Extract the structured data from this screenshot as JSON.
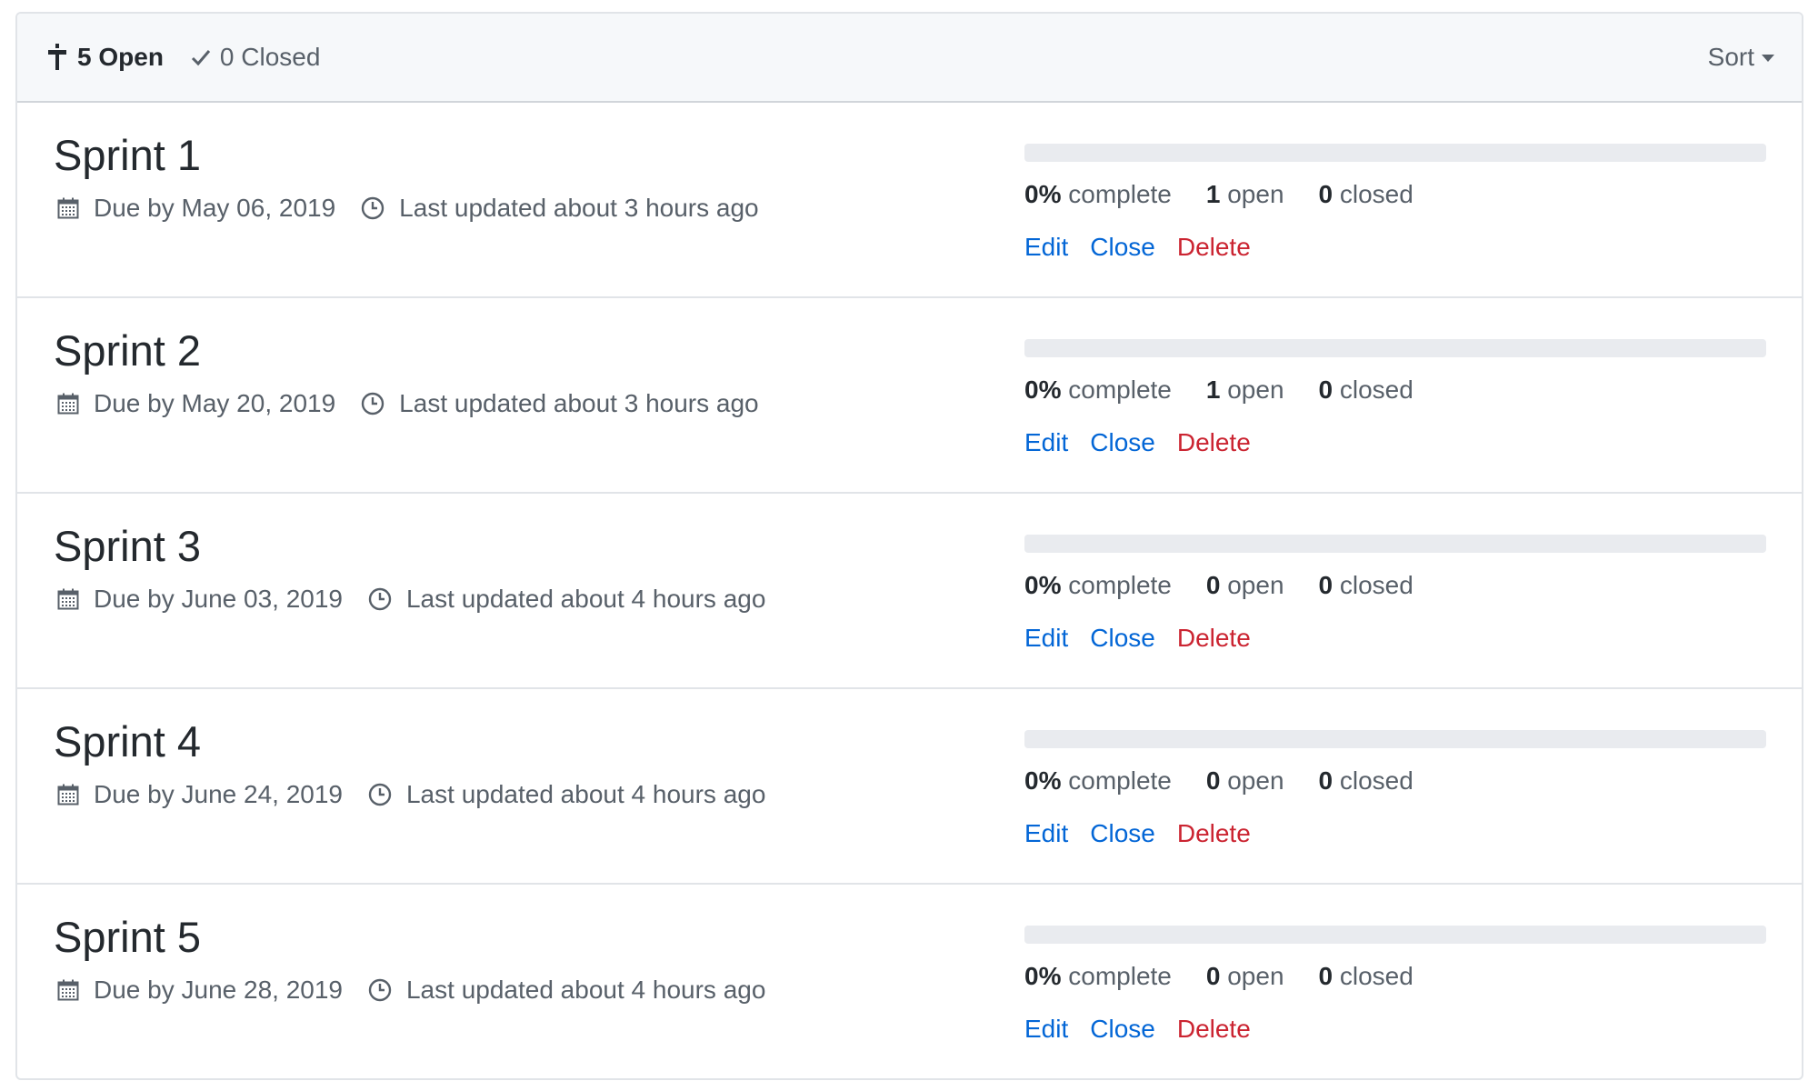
{
  "header": {
    "open_count": "5",
    "open_label": "Open",
    "closed_count": "0",
    "closed_label": "Closed",
    "sort_label": "Sort",
    "open_icon": "milestone-icon",
    "closed_icon": "check-icon"
  },
  "colors": {
    "link": "#0366d6",
    "danger": "#cb2431",
    "muted": "#586069",
    "progress_track": "#e9ebef"
  },
  "milestones": [
    {
      "title": "Sprint 1",
      "due": "Due by May 06, 2019",
      "updated": "Last updated about 3 hours ago",
      "percent": "0%",
      "complete_label": "complete",
      "open": "1",
      "open_label": "open",
      "closed": "0",
      "closed_label": "closed",
      "progress": 0,
      "actions": {
        "edit": "Edit",
        "close": "Close",
        "delete": "Delete"
      }
    },
    {
      "title": "Sprint 2",
      "due": "Due by May 20, 2019",
      "updated": "Last updated about 3 hours ago",
      "percent": "0%",
      "complete_label": "complete",
      "open": "1",
      "open_label": "open",
      "closed": "0",
      "closed_label": "closed",
      "progress": 0,
      "actions": {
        "edit": "Edit",
        "close": "Close",
        "delete": "Delete"
      }
    },
    {
      "title": "Sprint 3",
      "due": "Due by June 03, 2019",
      "updated": "Last updated about 4 hours ago",
      "percent": "0%",
      "complete_label": "complete",
      "open": "0",
      "open_label": "open",
      "closed": "0",
      "closed_label": "closed",
      "progress": 0,
      "actions": {
        "edit": "Edit",
        "close": "Close",
        "delete": "Delete"
      }
    },
    {
      "title": "Sprint 4",
      "due": "Due by June 24, 2019",
      "updated": "Last updated about 4 hours ago",
      "percent": "0%",
      "complete_label": "complete",
      "open": "0",
      "open_label": "open",
      "closed": "0",
      "closed_label": "closed",
      "progress": 0,
      "actions": {
        "edit": "Edit",
        "close": "Close",
        "delete": "Delete"
      }
    },
    {
      "title": "Sprint 5",
      "due": "Due by June 28, 2019",
      "updated": "Last updated about 4 hours ago",
      "percent": "0%",
      "complete_label": "complete",
      "open": "0",
      "open_label": "open",
      "closed": "0",
      "closed_label": "closed",
      "progress": 0,
      "actions": {
        "edit": "Edit",
        "close": "Close",
        "delete": "Delete"
      }
    }
  ]
}
